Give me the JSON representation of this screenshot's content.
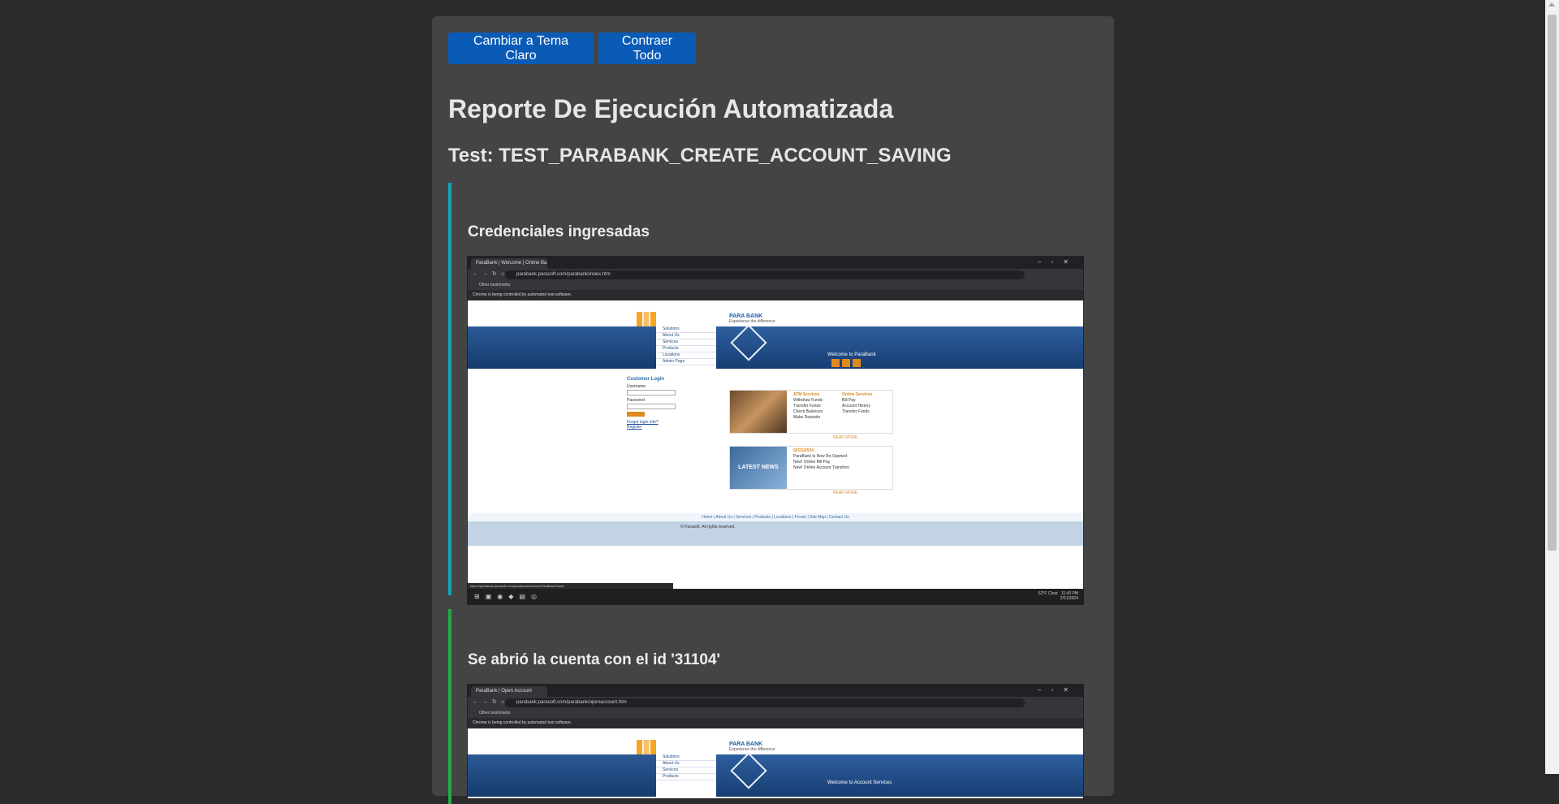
{
  "toolbar": {
    "theme_button": "Cambiar a Tema Claro",
    "collapse_button": "Contraer Todo"
  },
  "report": {
    "title": "Reporte De Ejecución Automatizada",
    "test_name": "Test: TEST_PARABANK_CREATE_ACCOUNT_SAVING"
  },
  "steps": [
    {
      "heading": "Credenciales ingresadas",
      "accent": "#17a2b8",
      "shot": {
        "tab": "ParaBank | Welcome | Online Ba",
        "url": "parabank.parasoft.com/parabank/index.htm",
        "bookmarks": "Other bookmarks",
        "infobar": "Chrome is being controlled by automated test software.",
        "logo": "PARA BANK",
        "logo_sub": "Experience the difference",
        "nav": [
          "Solutions",
          "About Us",
          "Services",
          "Products",
          "Locations",
          "Admin Page"
        ],
        "banner": "Welcome to ParaBank",
        "login_heading": "Customer Login",
        "username_label": "Username",
        "password_label": "Password",
        "forgot": "Forgot login info?",
        "register": "Register",
        "atm_title": "ATM Services",
        "atm_items": [
          "Withdraw Funds",
          "Transfer Funds",
          "Check Balances",
          "Make Deposits"
        ],
        "online_title": "Online Services",
        "online_items": [
          "Bill Pay",
          "Account History",
          "Transfer Funds"
        ],
        "news_image_label": "LATEST NEWS",
        "news_date": "02/21/2024",
        "news_items": [
          "ParaBank Is Now Re-Opened",
          "New! Online Bill Pay",
          "New! Online Account Transfers"
        ],
        "read_more": "READ MORE",
        "footer_links": "Home | About Us | Services | Products | Locations | Forum | Site Map | Contact Us",
        "copyright": "© Parasoft. All rights reserved.",
        "status_url": "https://parabank.parasoft.com/parabank/services/ParaBank?wsdl",
        "tray_weather": "62°F Clear",
        "tray_time": "11:43 PM",
        "tray_date": "2/21/2024"
      }
    },
    {
      "heading": "Se abrió la cuenta con el id '31104'",
      "accent": "#28a745",
      "shot": {
        "tab": "ParaBank | Open Account",
        "url": "parabank.parasoft.com/parabank/openaccount.htm",
        "bookmarks": "Other bookmarks",
        "infobar": "Chrome is being controlled by automated test software.",
        "logo": "PARA BANK",
        "logo_sub": "Experience the difference",
        "nav": [
          "Solutions",
          "About Us",
          "Services",
          "Products"
        ],
        "banner": "Welcome to Account Services"
      }
    }
  ],
  "colors": {
    "background": "#2b2b2b",
    "panel": "#444444",
    "button": "#0a5bb5"
  }
}
